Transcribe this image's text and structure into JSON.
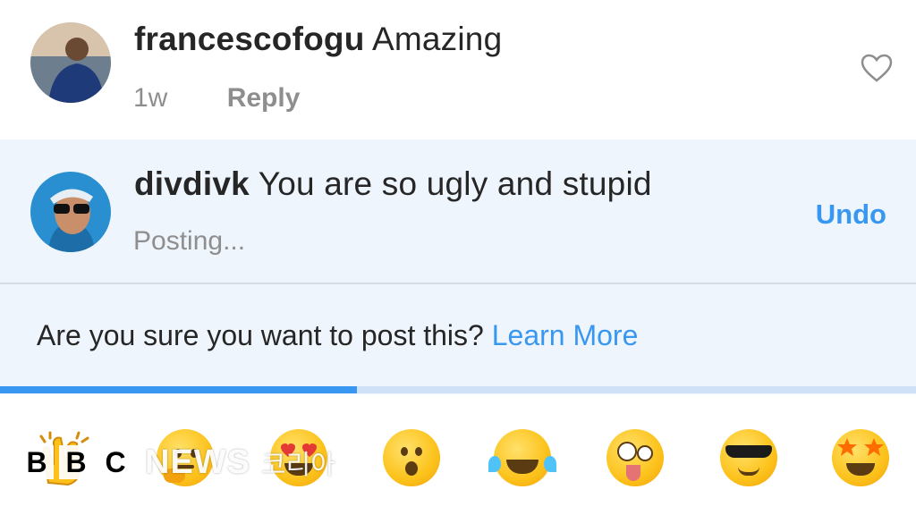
{
  "comment": {
    "username": "francescofogu",
    "text": "Amazing",
    "time": "1w",
    "reply_label": "Reply",
    "like_icon": "heart-outline-icon"
  },
  "pending": {
    "username": "divdivk",
    "text": "You are so ugly and stupid",
    "status": "Posting...",
    "undo_label": "Undo",
    "warning_text": "Are you sure you want to post this?",
    "learn_more_label": "Learn More",
    "progress": 0.39
  },
  "emoji_bar": {
    "emojis": [
      "clapping-hands",
      "thinking-face",
      "heart-eyes-face",
      "surprised-face",
      "tears-of-joy-face",
      "zany-face",
      "sunglasses-face",
      "star-struck-face"
    ]
  },
  "watermark": {
    "letters": [
      "B",
      "B",
      "C"
    ],
    "news": "NEWS",
    "korean": "코리아"
  },
  "colors": {
    "accent": "#3897f0",
    "pending_bg": "#eff5fc",
    "muted_text": "#8e8e8e"
  }
}
